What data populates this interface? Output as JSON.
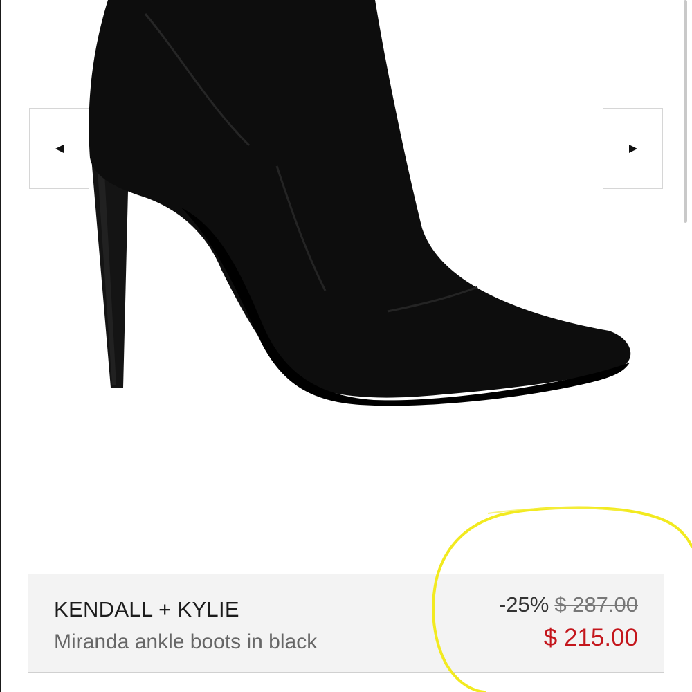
{
  "product": {
    "brand": "KENDALL + KYLIE",
    "name": "Miranda ankle boots in black",
    "image_alt": "black knit stiletto ankle boot"
  },
  "pricing": {
    "discount": "-25%",
    "original_price": "$ 287.00",
    "sale_price": "$ 215.00"
  },
  "gallery": {
    "prev_icon": "caret-left-icon",
    "next_icon": "caret-right-icon"
  },
  "colors": {
    "sale_price": "#c4161c",
    "card_background": "#f3f3f3",
    "annotation": "#f2ea1f",
    "boot": "#0d0d0d"
  }
}
